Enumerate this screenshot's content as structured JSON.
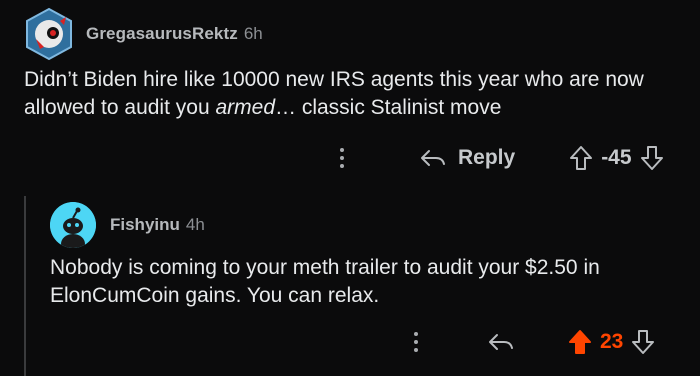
{
  "comment": {
    "author": "GregasaurusRektz",
    "age": "6h",
    "body_before": "Didn’t Biden hire like 10000 new IRS agents this year who are now allowed to audit you ",
    "body_em": "armed",
    "body_after": "… classic Stalinist move",
    "reply_label": "Reply",
    "score": "-45"
  },
  "reply": {
    "author": "Fishyinu",
    "age": "4h",
    "body": "Nobody is coming to your meth trailer to audit your $2.50 in ElonCumCoin gains. You can relax.",
    "score": "23"
  },
  "colors": {
    "background": "#0b0b0c",
    "upvoted": "#ff4500",
    "avatar_bg": "#4dd6f5"
  },
  "icons": [
    "more-options-icon",
    "reply-arrow-icon",
    "upvote-arrow-icon",
    "downvote-arrow-icon"
  ]
}
